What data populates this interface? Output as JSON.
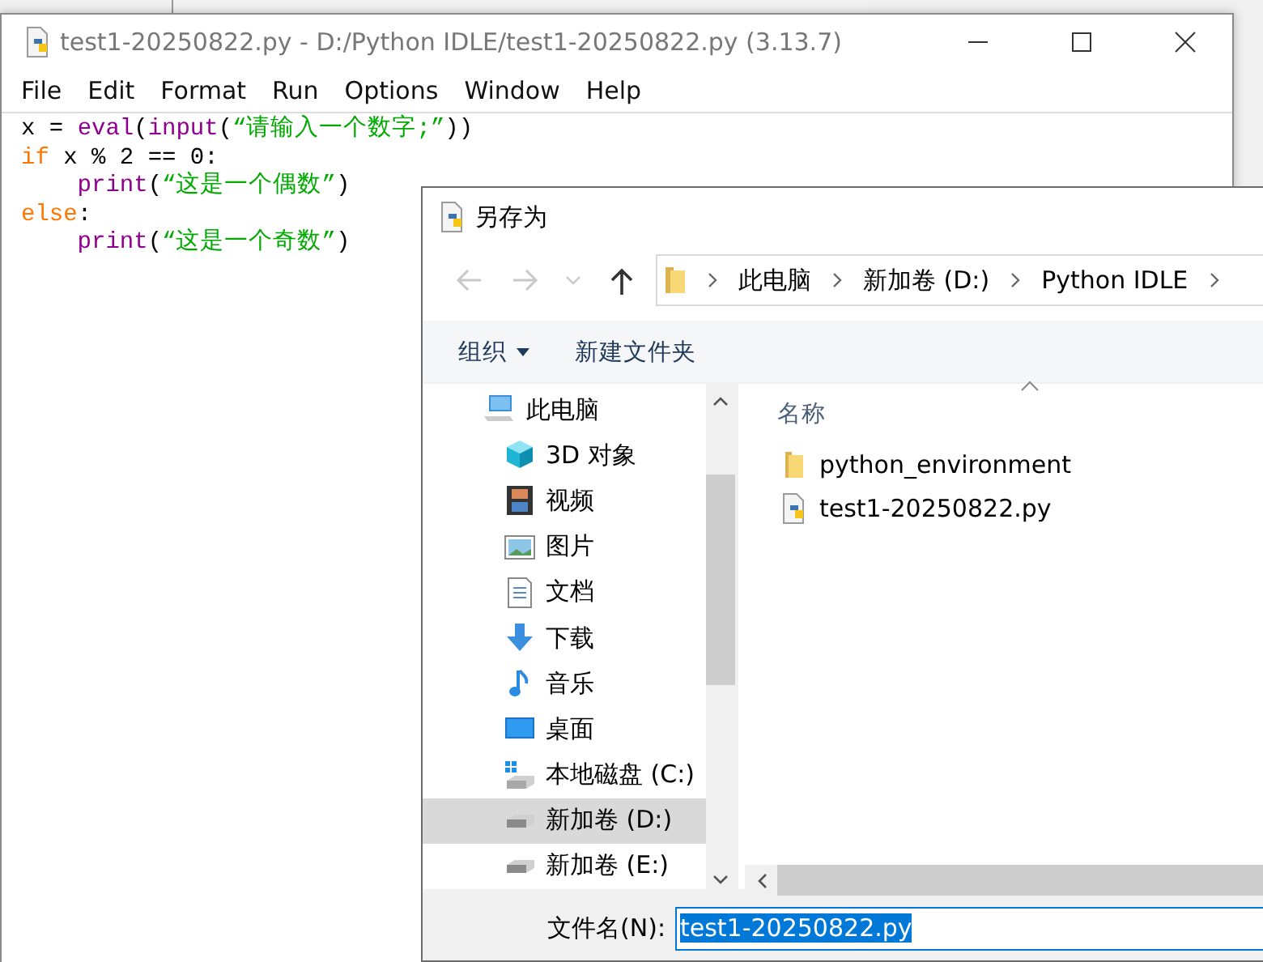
{
  "editor_window": {
    "title": "test1-20250822.py - D:/Python IDLE/test1-20250822.py (3.13.7)",
    "menu": [
      "File",
      "Edit",
      "Format",
      "Run",
      "Options",
      "Window",
      "Help"
    ],
    "code": [
      [
        {
          "text": "x = ",
          "kind": "plain"
        },
        {
          "text": "eval",
          "kind": "builtin"
        },
        {
          "text": "(",
          "kind": "plain"
        },
        {
          "text": "input",
          "kind": "builtin"
        },
        {
          "text": "(",
          "kind": "plain"
        },
        {
          "text": "“请输入一个数字;”",
          "kind": "string"
        },
        {
          "text": "))",
          "kind": "plain"
        }
      ],
      [
        {
          "text": "if",
          "kind": "keyword"
        },
        {
          "text": " x % 2 == 0:",
          "kind": "plain"
        }
      ],
      [
        {
          "text": "    print",
          "kind": "builtin"
        },
        {
          "text": "(",
          "kind": "plain"
        },
        {
          "text": "“这是一个偶数”",
          "kind": "string"
        },
        {
          "text": ")",
          "kind": "plain"
        }
      ],
      [
        {
          "text": "else",
          "kind": "keyword"
        },
        {
          "text": ":",
          "kind": "plain"
        }
      ],
      [
        {
          "text": "    print",
          "kind": "builtin"
        },
        {
          "text": "(",
          "kind": "plain"
        },
        {
          "text": "“这是一个奇数”",
          "kind": "string"
        },
        {
          "text": ")",
          "kind": "plain"
        }
      ]
    ]
  },
  "dialog": {
    "title": "另存为",
    "nav": [
      {
        "kind": "back",
        "disabled": true
      },
      {
        "kind": "forward",
        "disabled": true
      },
      {
        "kind": "recent",
        "disabled": true
      },
      {
        "kind": "up",
        "disabled": false
      }
    ],
    "breadcrumb": [
      "此电脑",
      "新加卷 (D:)",
      "Python IDLE"
    ],
    "toolbar": {
      "organize": "组织",
      "new_folder": "新建文件夹"
    },
    "sidebar": [
      {
        "label": "此电脑",
        "selected": false
      },
      {
        "label": "3D 对象",
        "selected": false
      },
      {
        "label": "视频",
        "selected": false
      },
      {
        "label": "图片",
        "selected": false
      },
      {
        "label": "文档",
        "selected": false
      },
      {
        "label": "下载",
        "selected": false
      },
      {
        "label": "音乐",
        "selected": false
      },
      {
        "label": "桌面",
        "selected": false
      },
      {
        "label": "本地磁盘 (C:)",
        "selected": false
      },
      {
        "label": "新加卷 (D:)",
        "selected": true
      },
      {
        "label": "新加卷 (E:)",
        "selected": false
      }
    ],
    "column_header": "名称",
    "files": [
      {
        "name": "python_environment",
        "kind": "folder"
      },
      {
        "name": "test1-20250822.py",
        "kind": "python"
      }
    ],
    "filename_label": "文件名(N):",
    "filename_value": "test1-20250822.py",
    "filename_selected": true
  }
}
